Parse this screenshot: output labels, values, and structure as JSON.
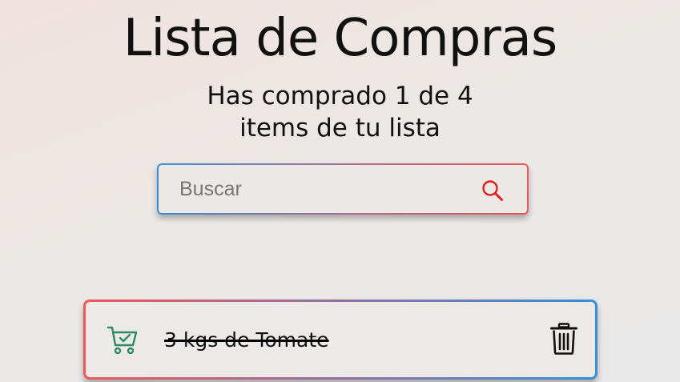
{
  "header": {
    "title": "Lista de Compras",
    "subtitle_line1": "Has comprado 1 de 4",
    "subtitle_line2": "items de tu lista"
  },
  "search": {
    "placeholder": "Buscar",
    "value": "",
    "icon": "search-icon",
    "icon_color": "#e02020"
  },
  "todos": [
    {
      "text": "3 kgs de Tomate",
      "completed": true,
      "check_icon": "cart-check-icon",
      "check_color": "#2a8a6a",
      "delete_icon": "trash-icon"
    }
  ],
  "colors": {
    "accent_blue": "#3b8fd6",
    "accent_red": "#e85a5a"
  }
}
